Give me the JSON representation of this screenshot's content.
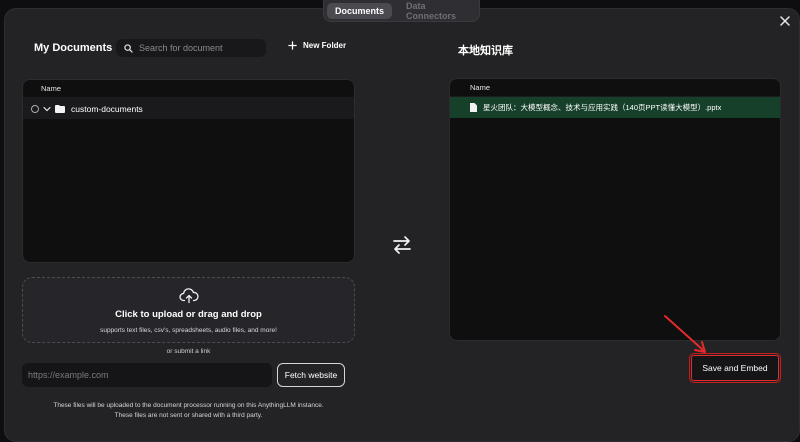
{
  "tabs": [
    {
      "label": "Documents",
      "active": true
    },
    {
      "label": "Data Connectors",
      "active": false
    }
  ],
  "left": {
    "title": "My Documents",
    "search_placeholder": "Search for document",
    "new_folder_label": "New Folder",
    "table_header": "Name",
    "folders": [
      {
        "name": "custom-documents"
      }
    ]
  },
  "upload": {
    "title": "Click to upload or drag and drop",
    "subtitle": "supports text files, csv's, spreadsheets, audio files, and more!",
    "or_link": "or submit a link",
    "url_placeholder": "https://example.com",
    "fetch_label": "Fetch website",
    "note_line1": "These files will be uploaded to the document processor running on this AnythingLLM instance.",
    "note_line2": "These files are not sent or shared with a third party."
  },
  "right": {
    "title": "本地知识库",
    "table_header": "Name",
    "files": [
      {
        "name": "星火团队：大模型概念、技术与应用实践（140页PPT读懂大模型）.pptx"
      }
    ],
    "save_label": "Save and Embed"
  },
  "colors": {
    "selected_row": "#17402a",
    "annotation_red": "#e42a2a"
  },
  "icons": [
    "close-icon",
    "search-icon",
    "plus-icon",
    "chevron-down-icon",
    "folder-icon",
    "cloud-upload-icon",
    "swap-arrows-icon",
    "file-icon"
  ]
}
